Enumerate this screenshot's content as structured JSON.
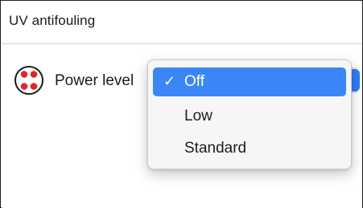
{
  "panel": {
    "title": "UV antifouling"
  },
  "setting": {
    "icon": "dots-circle-icon",
    "label": "Power level",
    "selected_value": "Off"
  },
  "dropdown": {
    "options": [
      {
        "label": "Off",
        "selected": true,
        "check_mark": "✓"
      },
      {
        "label": "Low",
        "selected": false
      },
      {
        "label": "Standard",
        "selected": false
      }
    ]
  },
  "colors": {
    "accent": "#3b86f7",
    "icon_red": "#e0252b",
    "frame": "#1f1f1f"
  }
}
